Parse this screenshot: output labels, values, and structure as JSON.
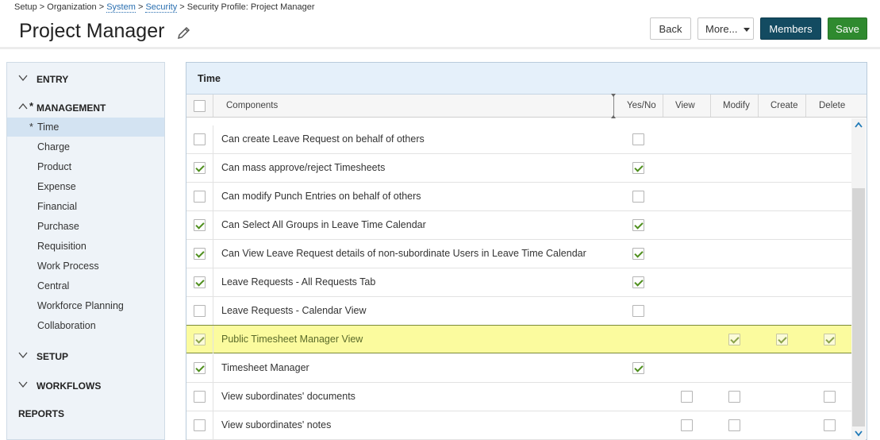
{
  "breadcrumb": {
    "setup": "Setup",
    "sep1": " > ",
    "organization": "Organization",
    "sep2": " > ",
    "system": "System",
    "sep3": " > ",
    "security": "Security",
    "sep4": " > ",
    "current": "Security Profile: Project Manager"
  },
  "page_title": "Project Manager",
  "toolbar": {
    "back": "Back",
    "more": "More...",
    "members": "Members",
    "save": "Save"
  },
  "sidebar": {
    "entry": "ENTRY",
    "management": "MANAGEMENT",
    "management_star": "*",
    "items": [
      {
        "label": "Time",
        "star": "*",
        "active": true
      },
      {
        "label": "Charge"
      },
      {
        "label": "Product"
      },
      {
        "label": "Expense"
      },
      {
        "label": "Financial"
      },
      {
        "label": "Purchase"
      },
      {
        "label": "Requisition"
      },
      {
        "label": "Work Process"
      },
      {
        "label": "Central"
      },
      {
        "label": "Workforce Planning"
      },
      {
        "label": "Collaboration"
      }
    ],
    "setup": "SETUP",
    "workflows": "WORKFLOWS",
    "reports": "REPORTS"
  },
  "panel": {
    "title": "Time",
    "columns": {
      "components": "Components",
      "yesno": "Yes/No",
      "view": "View",
      "modify": "Modify",
      "create": "Create",
      "delete": "Delete"
    }
  },
  "rows": [
    {
      "name": "Can create Leave Request on behalf of others",
      "selected": false,
      "yesno": false
    },
    {
      "name": "Can mass approve/reject Timesheets",
      "selected": true,
      "yesno": true
    },
    {
      "name": "Can modify Punch Entries on behalf of others",
      "selected": false,
      "yesno": false
    },
    {
      "name": "Can Select All Groups in Leave Time Calendar",
      "selected": true,
      "yesno": true
    },
    {
      "name": "Can View Leave Request details of non-subordinate Users in Leave Time Calendar",
      "selected": true,
      "yesno": true
    },
    {
      "name": "Leave Requests - All Requests Tab",
      "selected": true,
      "yesno": true
    },
    {
      "name": "Leave Requests - Calendar View",
      "selected": false,
      "yesno": false
    },
    {
      "name": "Public Timesheet Manager View",
      "selected": true,
      "highlighted": true,
      "modify": true,
      "create": true,
      "delete": true
    },
    {
      "name": "Timesheet Manager",
      "selected": true,
      "yesno": true
    },
    {
      "name": "View subordinates' documents",
      "selected": false,
      "view": false,
      "modify": false,
      "delete": false
    },
    {
      "name": "View subordinates' notes",
      "selected": false,
      "view": false,
      "modify": false,
      "delete": false
    }
  ],
  "colors": {
    "members_button": "#134b61",
    "save_button": "#2f8a2f",
    "highlight": "#fbfb9e",
    "check": "#4f8f1e",
    "link": "#2a6fb0"
  }
}
